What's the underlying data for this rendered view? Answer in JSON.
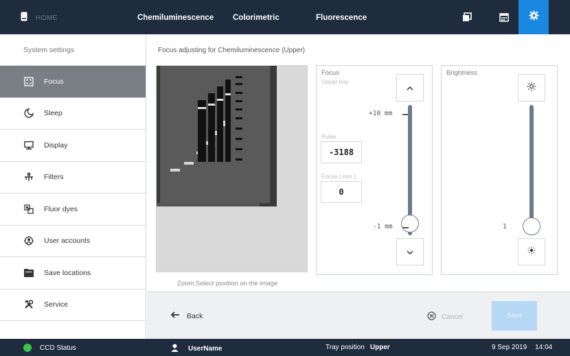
{
  "topbar": {
    "home_label": "HOME",
    "tabs": [
      "Chemiluminescence",
      "Colorimetric",
      "Fluorescence"
    ],
    "icons": [
      "gallery-icon",
      "calendar-icon",
      "gear-icon"
    ]
  },
  "sidebar": {
    "title": "System settings",
    "items": [
      {
        "label": "Focus",
        "icon": "focus-icon",
        "active": true
      },
      {
        "label": "Sleep",
        "icon": "sleep-icon",
        "active": false
      },
      {
        "label": "Display",
        "icon": "display-icon",
        "active": false
      },
      {
        "label": "Filters",
        "icon": "filters-icon",
        "active": false
      },
      {
        "label": "Fluor dyes",
        "icon": "fluor-dyes-icon",
        "active": false
      },
      {
        "label": "User accounts",
        "icon": "user-accounts-icon",
        "active": false
      },
      {
        "label": "Save locations",
        "icon": "save-locations-icon",
        "active": false
      },
      {
        "label": "Service",
        "icon": "service-icon",
        "active": false
      }
    ]
  },
  "main": {
    "title": "Focus adjusting for Chemiluminescence (Upper)",
    "zoom_hint": "Zoom:Select position on the image",
    "focus": {
      "label": "Focus",
      "sublabel": "Upper tray",
      "top_mark": "+10 mm",
      "bottom_mark": "-1 mm",
      "pulse_label": "Pulse",
      "pulse_value": "-3188",
      "focus_mm_label": "Focus ( mm )",
      "focus_mm_value": "0",
      "slider_fraction": 0.05
    },
    "brightness": {
      "label": "Brightness",
      "mark": "1",
      "slider_fraction": 0.0
    }
  },
  "actions": {
    "back": "Back",
    "cancel": "Cancel",
    "save": "Save"
  },
  "status": {
    "ccd": "CCD Status",
    "user": "UserName",
    "tray_label": "Tray position",
    "tray_value": "Upper",
    "date": "9 Sep 2019",
    "time": "14:04"
  },
  "colors": {
    "topbar": "#1f2c3e",
    "accent": "#1a88e0",
    "active_item": "#7a7f86",
    "status_ok": "#3cc44a"
  }
}
